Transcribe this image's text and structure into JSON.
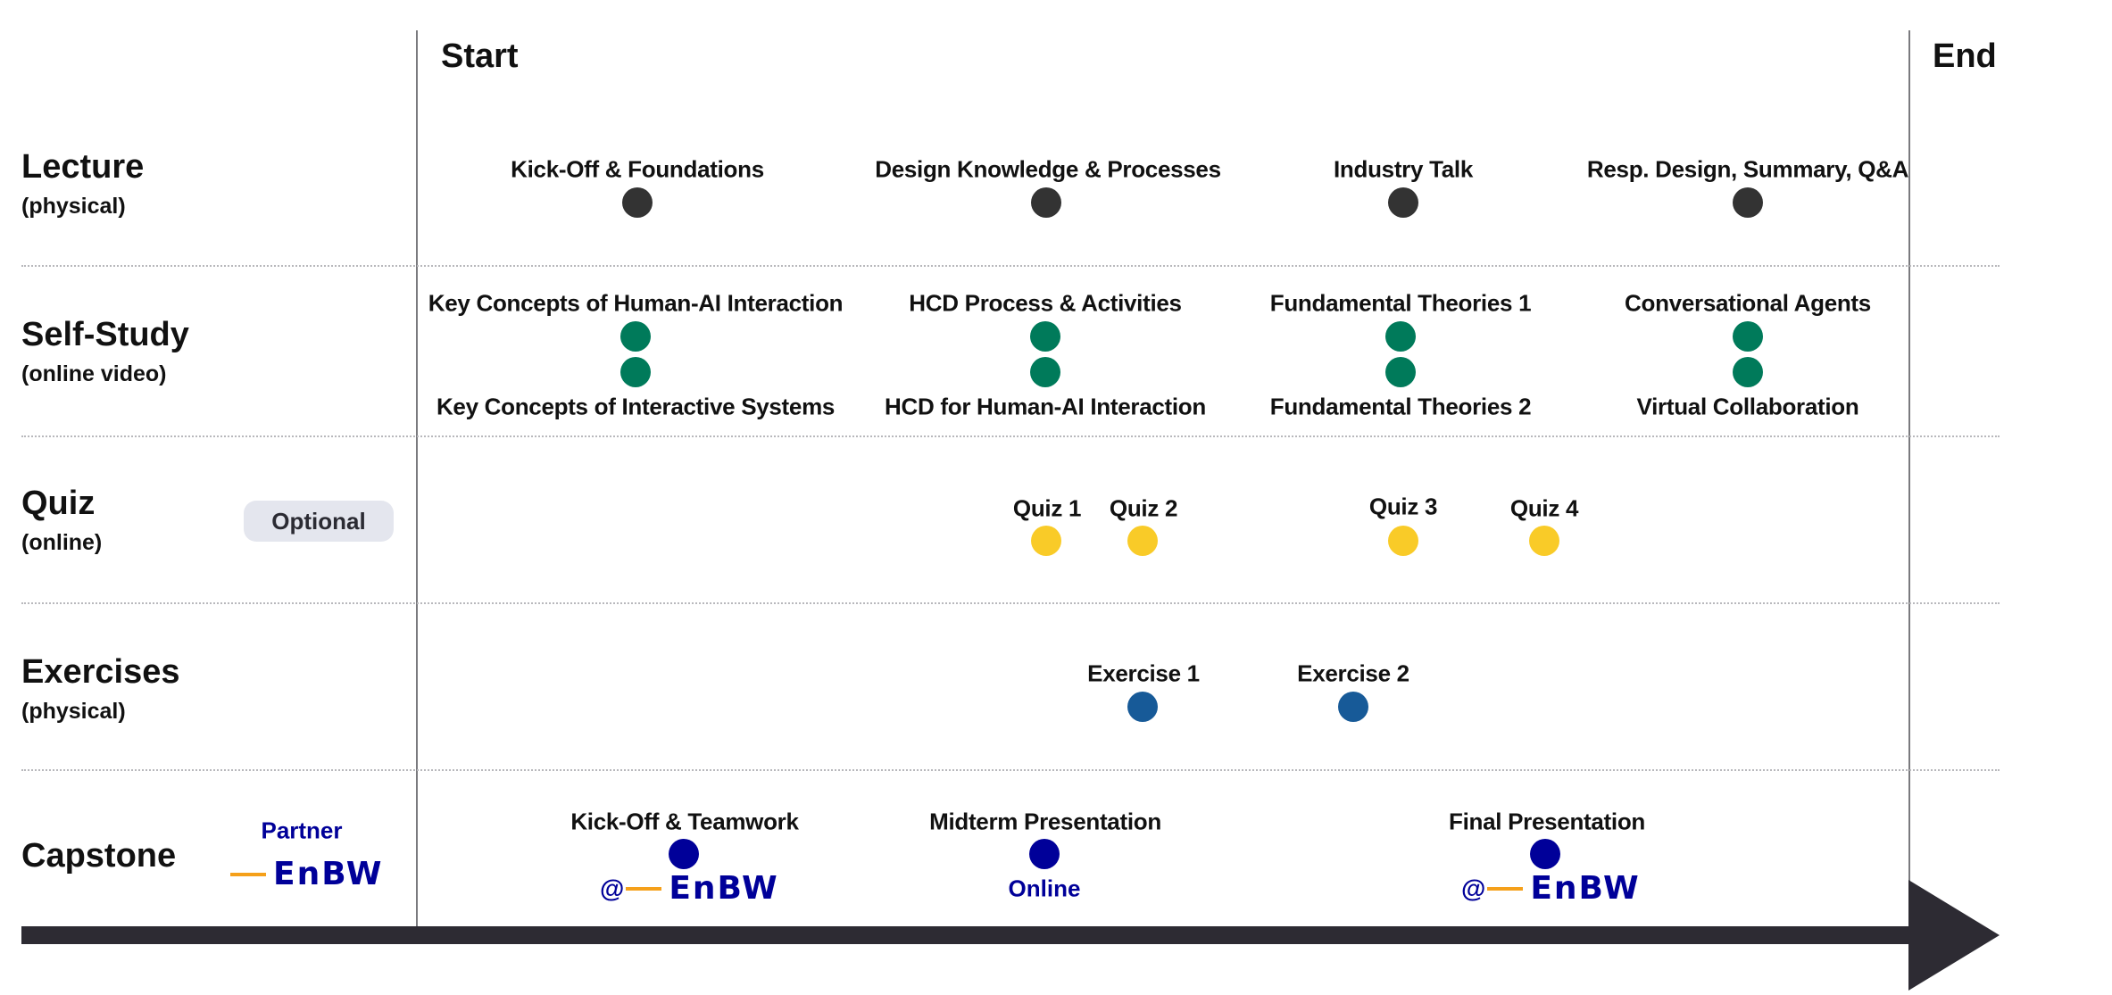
{
  "phases": {
    "start": "Start",
    "end": "End"
  },
  "colors": {
    "lecture": "#333333",
    "self_study": "#007a5a",
    "quiz": "#f9cb28",
    "exercise": "#175a98",
    "capstone": "#000099",
    "partner_text": "#000099",
    "arrow": "#2d2b33",
    "optional_pill": "#e4e6ee",
    "enbw_orange": "#f5a01a"
  },
  "rows": [
    {
      "id": "lecture",
      "title": "Lecture",
      "subtitle": "(physical)"
    },
    {
      "id": "self_study",
      "title": "Self-Study",
      "subtitle": "(online video)"
    },
    {
      "id": "quiz",
      "title": "Quiz",
      "subtitle": "(online)",
      "badge": "Optional"
    },
    {
      "id": "exercises",
      "title": "Exercises",
      "subtitle": "(physical)"
    },
    {
      "id": "capstone",
      "title": "Capstone",
      "partner_label": "Partner",
      "partner_logo": "EnBW"
    }
  ],
  "lecture": [
    "Kick-Off & Foundations",
    "Design Knowledge & Processes",
    "Industry Talk",
    "Resp. Design, Summary, Q&A"
  ],
  "self_study": [
    {
      "top": "Key Concepts of Human-AI Interaction",
      "bottom": "Key Concepts of Interactive Systems"
    },
    {
      "top": "HCD Process & Activities",
      "bottom": "HCD for Human-AI Interaction"
    },
    {
      "top": "Fundamental Theories 1",
      "bottom": "Fundamental Theories 2"
    },
    {
      "top": "Conversational Agents",
      "bottom": "Virtual Collaboration"
    }
  ],
  "quiz": [
    "Quiz 1",
    "Quiz 2",
    "Quiz 3",
    "Quiz 4"
  ],
  "exercises": [
    "Exercise 1",
    "Exercise 2"
  ],
  "capstone": [
    {
      "label": "Kick-Off & Teamwork",
      "location_prefix": "@",
      "location": "EnBW"
    },
    {
      "label": "Midterm Presentation",
      "location": "Online"
    },
    {
      "label": "Final Presentation",
      "location_prefix": "@",
      "location": "EnBW"
    }
  ]
}
